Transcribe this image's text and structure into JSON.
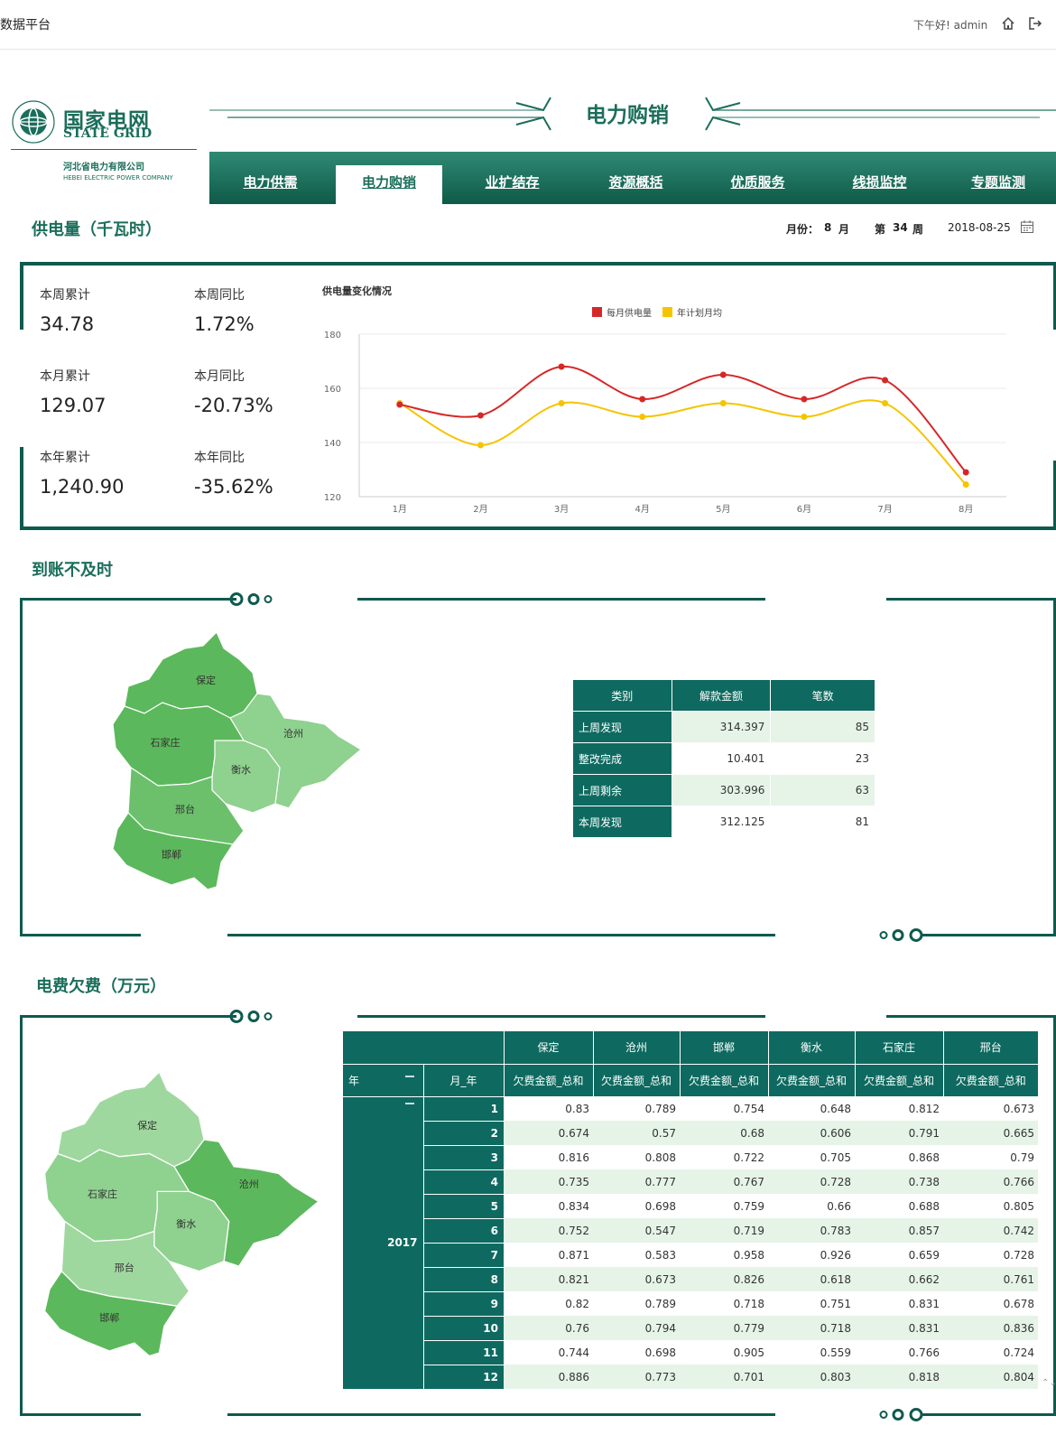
{
  "header": {
    "app_title": "数据平台",
    "greeting": "下午好! admin",
    "home_icon": "home-icon",
    "logout_icon": "logout-icon"
  },
  "logo": {
    "name_cn": "国家电网",
    "name_en": "STATE GRID",
    "company_cn": "河北省电力有限公司",
    "company_en": "HEBEI ELECTRIC POWER COMPANY"
  },
  "page_title": "电力购销",
  "nav": {
    "items": [
      "电力供需",
      "电力购销",
      "业扩结存",
      "资源概括",
      "优质服务",
      "线损监控",
      "专题监测"
    ],
    "active_index": 1
  },
  "section1": {
    "title": "供电量（千瓦时）",
    "month_label": "月份：",
    "month_value": "8",
    "month_unit": "月",
    "week_prefix": "第",
    "week_value": "34",
    "week_unit": "周",
    "date": "2018-08-25",
    "kpis": [
      {
        "label": "本周累计",
        "value": "34.78"
      },
      {
        "label": "本周同比",
        "value": "1.72%"
      },
      {
        "label": "本月累计",
        "value": "129.07"
      },
      {
        "label": "本月同比",
        "value": "-20.73%"
      },
      {
        "label": "本年累计",
        "value": "1,240.90"
      },
      {
        "label": "本年同比",
        "value": "-35.62%"
      }
    ]
  },
  "chart_data": {
    "type": "line",
    "title": "供电量变化情况",
    "categories": [
      "1月",
      "2月",
      "3月",
      "4月",
      "5月",
      "6月",
      "7月",
      "8月"
    ],
    "series": [
      {
        "name": "每月供电量",
        "color": "#d62728",
        "values": [
          154,
          150,
          168,
          156,
          165,
          156,
          163,
          129
        ]
      },
      {
        "name": "年计划月均",
        "color": "#f5c400",
        "values": [
          154.5,
          139,
          154.5,
          149.5,
          154.5,
          149.5,
          154.5,
          124.5
        ]
      }
    ],
    "ylim": [
      120,
      180
    ],
    "yticks": [
      120,
      140,
      160,
      180
    ],
    "legend": "top-center",
    "grid": true,
    "smooth": true
  },
  "section2": {
    "title": "到账不及时",
    "map_labels": [
      "保定",
      "沧州",
      "石家庄",
      "衡水",
      "邢台",
      "邯郸"
    ],
    "table": {
      "headers": [
        "类别",
        "解款金额",
        "笔数"
      ],
      "rows": [
        [
          "上周发现",
          "314.397",
          "85"
        ],
        [
          "整改完成",
          "10.401",
          "23"
        ],
        [
          "上周剩余",
          "303.996",
          "63"
        ],
        [
          "本周发现",
          "312.125",
          "81"
        ]
      ]
    }
  },
  "section3": {
    "title": "电费欠费（万元）",
    "map_labels": [
      "保定",
      "沧州",
      "石家庄",
      "衡水",
      "邢台",
      "邯郸"
    ],
    "table": {
      "cities": [
        "保定",
        "沧州",
        "邯郸",
        "衡水",
        "石家庄",
        "邢台"
      ],
      "col_year": "年",
      "col_month": "月_年",
      "measure": "欠费金额_总和",
      "year": "2017",
      "rows": [
        [
          "1",
          "0.83",
          "0.789",
          "0.754",
          "0.648",
          "0.812",
          "0.673"
        ],
        [
          "2",
          "0.674",
          "0.57",
          "0.68",
          "0.606",
          "0.791",
          "0.665"
        ],
        [
          "3",
          "0.816",
          "0.808",
          "0.722",
          "0.705",
          "0.868",
          "0.79"
        ],
        [
          "4",
          "0.735",
          "0.777",
          "0.767",
          "0.728",
          "0.738",
          "0.766"
        ],
        [
          "5",
          "0.834",
          "0.698",
          "0.759",
          "0.66",
          "0.688",
          "0.805"
        ],
        [
          "6",
          "0.752",
          "0.547",
          "0.719",
          "0.783",
          "0.857",
          "0.742"
        ],
        [
          "7",
          "0.871",
          "0.583",
          "0.958",
          "0.926",
          "0.659",
          "0.728"
        ],
        [
          "8",
          "0.821",
          "0.673",
          "0.826",
          "0.618",
          "0.662",
          "0.761"
        ],
        [
          "9",
          "0.82",
          "0.789",
          "0.718",
          "0.751",
          "0.831",
          "0.678"
        ],
        [
          "10",
          "0.76",
          "0.794",
          "0.779",
          "0.718",
          "0.831",
          "0.836"
        ],
        [
          "11",
          "0.744",
          "0.698",
          "0.905",
          "0.559",
          "0.766",
          "0.724"
        ],
        [
          "12",
          "0.886",
          "0.773",
          "0.701",
          "0.803",
          "0.818",
          "0.804"
        ]
      ]
    }
  }
}
